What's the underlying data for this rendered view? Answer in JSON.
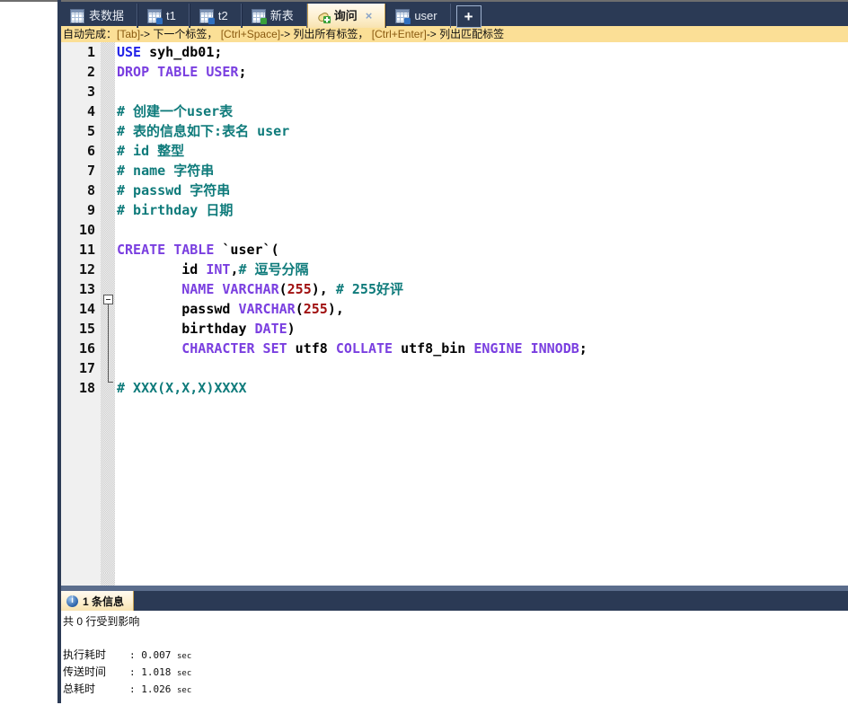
{
  "window": {
    "left_rail_label": ""
  },
  "tabs": {
    "items": [
      {
        "label": "表数据",
        "icon": "table-icon",
        "active": false,
        "closable": false
      },
      {
        "label": "t1",
        "icon": "table-plus-icon",
        "active": false,
        "closable": false
      },
      {
        "label": "t2",
        "icon": "table-plus-icon",
        "active": false,
        "closable": false
      },
      {
        "label": "新表",
        "icon": "table-new-icon",
        "active": false,
        "closable": false
      },
      {
        "label": "询问",
        "icon": "query-icon",
        "active": true,
        "closable": true
      },
      {
        "label": "user",
        "icon": "table-plus-icon",
        "active": false,
        "closable": false
      }
    ],
    "close_glyph": "×",
    "add_label": "+"
  },
  "hintbar": {
    "prefix": "自动完成：",
    "segments": [
      {
        "key": "[Tab]",
        "desc": "-> 下一个标签，"
      },
      {
        "key": "[Ctrl+Space]",
        "desc": "-> 列出所有标签，"
      },
      {
        "key": "[Ctrl+Enter]",
        "desc": "-> 列出匹配标签"
      }
    ],
    "full_text": "自动完成： [Tab]-> 下一个标签， [Ctrl+Space]-> 列出所有标签， [Ctrl+Enter]-> 列出匹配标签"
  },
  "editor": {
    "line_numbers": [
      "1",
      "2",
      "3",
      "4",
      "5",
      "6",
      "7",
      "8",
      "9",
      "10",
      "11",
      "12",
      "13",
      "14",
      "15",
      "16",
      "17",
      "18"
    ],
    "lines": [
      {
        "n": 1,
        "tokens": [
          {
            "t": "USE",
            "c": "kwb"
          },
          {
            "t": " syh_db01;",
            "c": "id"
          }
        ]
      },
      {
        "n": 2,
        "tokens": [
          {
            "t": "DROP TABLE USER",
            "c": "kw"
          },
          {
            "t": ";",
            "c": "id"
          }
        ]
      },
      {
        "n": 3,
        "tokens": []
      },
      {
        "n": 4,
        "tokens": [
          {
            "t": "# 创建一个user表",
            "c": "cm"
          }
        ]
      },
      {
        "n": 5,
        "tokens": [
          {
            "t": "# 表的信息如下:表名 user",
            "c": "cm"
          }
        ]
      },
      {
        "n": 6,
        "tokens": [
          {
            "t": "# id 整型",
            "c": "cm"
          }
        ]
      },
      {
        "n": 7,
        "tokens": [
          {
            "t": "# name 字符串",
            "c": "cm"
          }
        ]
      },
      {
        "n": 8,
        "tokens": [
          {
            "t": "# passwd 字符串",
            "c": "cm"
          }
        ]
      },
      {
        "n": 9,
        "tokens": [
          {
            "t": "# birthday 日期",
            "c": "cm"
          }
        ]
      },
      {
        "n": 10,
        "tokens": []
      },
      {
        "n": 11,
        "tokens": [
          {
            "t": "CREATE TABLE",
            "c": "kw"
          },
          {
            "t": " `user`(",
            "c": "id"
          }
        ]
      },
      {
        "n": 12,
        "tokens": [
          {
            "t": "        id ",
            "c": "id"
          },
          {
            "t": "INT",
            "c": "kw"
          },
          {
            "t": ",",
            "c": "id"
          },
          {
            "t": "# 逗号分隔",
            "c": "cm"
          }
        ]
      },
      {
        "n": 13,
        "tokens": [
          {
            "t": "        ",
            "c": "id"
          },
          {
            "t": "NAME VARCHAR",
            "c": "kw"
          },
          {
            "t": "(",
            "c": "id"
          },
          {
            "t": "255",
            "c": "num"
          },
          {
            "t": "), ",
            "c": "id"
          },
          {
            "t": "# 255好评",
            "c": "cm"
          }
        ]
      },
      {
        "n": 14,
        "tokens": [
          {
            "t": "        passwd ",
            "c": "id"
          },
          {
            "t": "VARCHAR",
            "c": "kw"
          },
          {
            "t": "(",
            "c": "id"
          },
          {
            "t": "255",
            "c": "num"
          },
          {
            "t": "),",
            "c": "id"
          }
        ]
      },
      {
        "n": 15,
        "tokens": [
          {
            "t": "        birthday ",
            "c": "id"
          },
          {
            "t": "DATE",
            "c": "kw"
          },
          {
            "t": ")",
            "c": "id"
          }
        ]
      },
      {
        "n": 16,
        "tokens": [
          {
            "t": "        ",
            "c": "id"
          },
          {
            "t": "CHARACTER SET",
            "c": "kw"
          },
          {
            "t": " utf8 ",
            "c": "id"
          },
          {
            "t": "COLLATE",
            "c": "kw"
          },
          {
            "t": " utf8_bin ",
            "c": "id"
          },
          {
            "t": "ENGINE INNODB",
            "c": "kw"
          },
          {
            "t": ";",
            "c": "id"
          }
        ]
      },
      {
        "n": 17,
        "tokens": []
      },
      {
        "n": 18,
        "tokens": [
          {
            "t": "# XXX(X,X,X)XXXX",
            "c": "cm"
          }
        ]
      }
    ]
  },
  "results": {
    "tab_label": "1 条信息",
    "info_glyph": "i",
    "summary": "共 0 行受到影响",
    "log": [
      {
        "label": "执行耗时",
        "sep": ": ",
        "value": "0.007",
        "unit": "sec"
      },
      {
        "label": "传送时间",
        "sep": ": ",
        "value": "1.018",
        "unit": "sec"
      },
      {
        "label": "总耗时",
        "sep": ": ",
        "value": "1.026",
        "unit": "sec"
      }
    ]
  },
  "colors": {
    "chrome_navy": "#2b3a55",
    "active_tab": "#fdf0d0",
    "hint_bar": "#fbdf96",
    "gutter": "#f0f0f0",
    "keyword_purple": "#7a3fe0",
    "keyword_blue": "#2323e8",
    "comment_teal": "#0f7b7b",
    "number_red": "#a01010"
  }
}
